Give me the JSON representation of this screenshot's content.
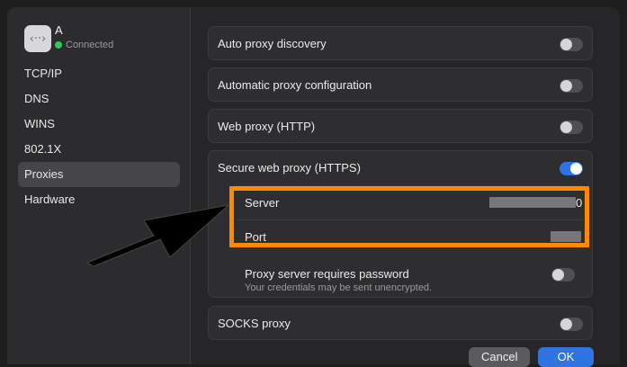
{
  "sidebar": {
    "network": {
      "icon": "network-arrows-icon",
      "name": "A",
      "status": "Connected"
    },
    "items": [
      {
        "label": "TCP/IP",
        "active": false
      },
      {
        "label": "DNS",
        "active": false
      },
      {
        "label": "WINS",
        "active": false
      },
      {
        "label": "802.1X",
        "active": false
      },
      {
        "label": "Proxies",
        "active": true
      },
      {
        "label": "Hardware",
        "active": false
      }
    ]
  },
  "main": {
    "auto_discovery": {
      "label": "Auto proxy discovery",
      "enabled": false
    },
    "auto_config": {
      "label": "Automatic proxy configuration",
      "enabled": false
    },
    "web_proxy": {
      "label": "Web proxy (HTTP)",
      "enabled": false
    },
    "secure_proxy": {
      "label": "Secure web proxy (HTTPS)",
      "enabled": true,
      "server": {
        "label": "Server",
        "value_suffix": "0"
      },
      "port": {
        "label": "Port"
      },
      "password": {
        "label": "Proxy server requires password",
        "note": "Your credentials may be sent unencrypted.",
        "enabled": false
      }
    },
    "socks_proxy": {
      "label": "SOCKS proxy",
      "enabled": false
    }
  },
  "footer": {
    "cancel_label": "Cancel",
    "ok_label": "OK"
  },
  "colors": {
    "highlight": "#ff8a00",
    "toggle_on": "#2f74e0",
    "status_dot": "#32c759"
  }
}
